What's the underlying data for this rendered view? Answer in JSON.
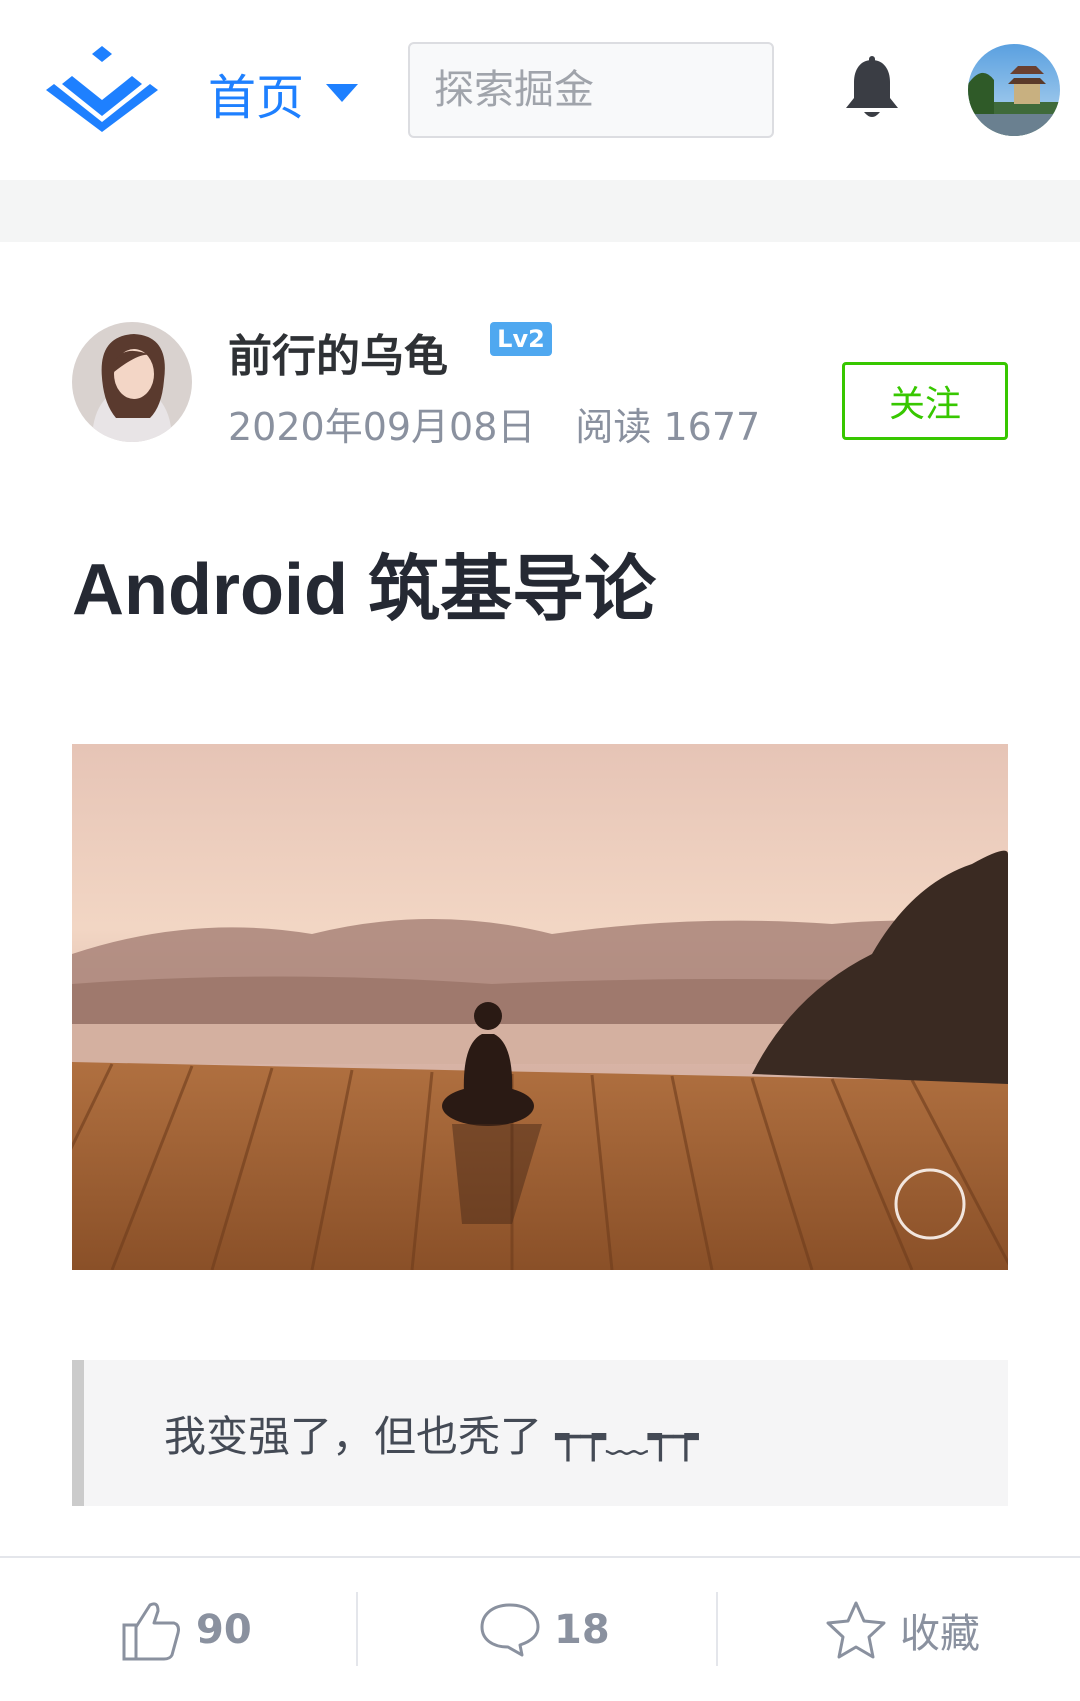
{
  "header": {
    "nav_label": "首页",
    "search_placeholder": "探索掘金"
  },
  "author": {
    "name": "前行的乌龟",
    "level": "Lv2",
    "date": "2020年09月08日",
    "reads": "阅读 1677",
    "follow_label": "关注"
  },
  "article": {
    "title": "Android 筑基导论",
    "quote": "我变强了，但也秃了 ┭┮﹏┭┮"
  },
  "actions": {
    "likes": "90",
    "comments": "18",
    "collect_label": "收藏"
  },
  "colors": {
    "brand": "#1e80ff",
    "follow": "#37c700",
    "muted": "#8a919f"
  }
}
